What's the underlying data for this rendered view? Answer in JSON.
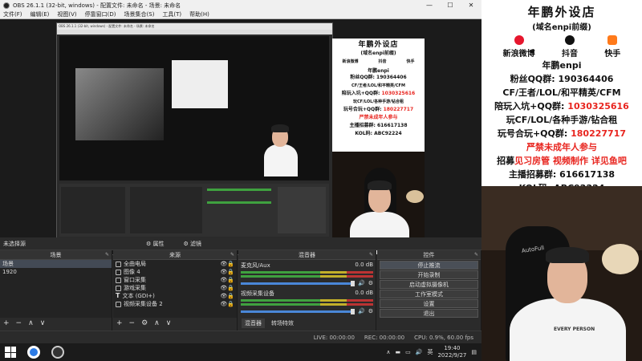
{
  "window": {
    "title": "OBS 26.1.1 (32-bit, windows) - 配置文件: 未命名 - 场景: 未命名",
    "controls": [
      "—",
      "☐",
      "✕"
    ]
  },
  "menu": [
    "文件(F)",
    "编辑(E)",
    "视图(V)",
    "停靠窗口(D)",
    "场景集合(S)",
    "工具(T)",
    "帮助(H)"
  ],
  "status_strip": {
    "no_source": "未选择源",
    "properties": "属性",
    "filters": "滤镜"
  },
  "scenes": {
    "header": "场景",
    "items": [
      "场景",
      "1920"
    ],
    "tools": [
      "+",
      "−",
      "∧",
      "∨"
    ]
  },
  "sources": {
    "header": "来源",
    "items": [
      {
        "label": "全曲电局",
        "icon": "image-icon"
      },
      {
        "label": "图像 4",
        "icon": "image-icon"
      },
      {
        "label": "窗口采集",
        "icon": "window-icon"
      },
      {
        "label": "游戏采集",
        "icon": "game-icon"
      },
      {
        "label": "文本 (GDI+)",
        "icon": "text-icon"
      },
      {
        "label": "视频采集设备 2",
        "icon": "camera-icon"
      }
    ],
    "tools": [
      "+",
      "−",
      "⚙",
      "∧",
      "∨"
    ]
  },
  "mixer": {
    "header": "混音器",
    "channels": [
      {
        "name": "麦克风/Aux",
        "db": "0.0 dB"
      },
      {
        "name": "视频采集设备",
        "db": "0.0 dB"
      }
    ],
    "tabs": [
      "混音器",
      "转场特效"
    ]
  },
  "controls": {
    "header": "控件",
    "buttons": [
      "停止推流",
      "开始录制",
      "启动虚拟摄像机",
      "工作室模式",
      "设置",
      "退出"
    ]
  },
  "status_bar": {
    "live": "LIVE: 00:00:00",
    "rec": "REC: 00:00:00",
    "cpu": "CPU: 0.9%, 60.00 fps"
  },
  "taskbar": {
    "time": "19:40",
    "date": "2022/9/27",
    "ime": "英"
  },
  "sign": {
    "title": "年鹏外设店",
    "subtitle": "(域名enpi前缀)",
    "social": [
      {
        "label": "新浪微博",
        "color": "#e6162d"
      },
      {
        "label": "抖音",
        "color": "#111111"
      },
      {
        "label": "快手",
        "color": "#ff7a1a"
      }
    ],
    "name": "年鹏enpi",
    "lines": [
      {
        "text": "粉丝QQ群: 190364406",
        "red": false
      },
      {
        "text": "CF/王者/LOL/和平精英/CFM",
        "red": false
      },
      {
        "text_black": "陪玩入坑+QQ群: ",
        "text_red": "1030325616"
      },
      {
        "text": "玩CF/LOL/各种手游/钻合租",
        "red": false
      },
      {
        "text_black": "玩号合玩+QQ群: ",
        "text_red": "180227717"
      },
      {
        "text": "严禁未成年人参与",
        "red": true
      }
    ],
    "recruit": {
      "a": "招募",
      "b": "见习房管",
      "c": "视频制作",
      "d": "详见鱼吧"
    },
    "anchor": "主播招募群: 616617138",
    "kol": "KOL码: ABC92224"
  },
  "chair_brand": "AutoFull",
  "shirt_text": "EVERY PERSON"
}
